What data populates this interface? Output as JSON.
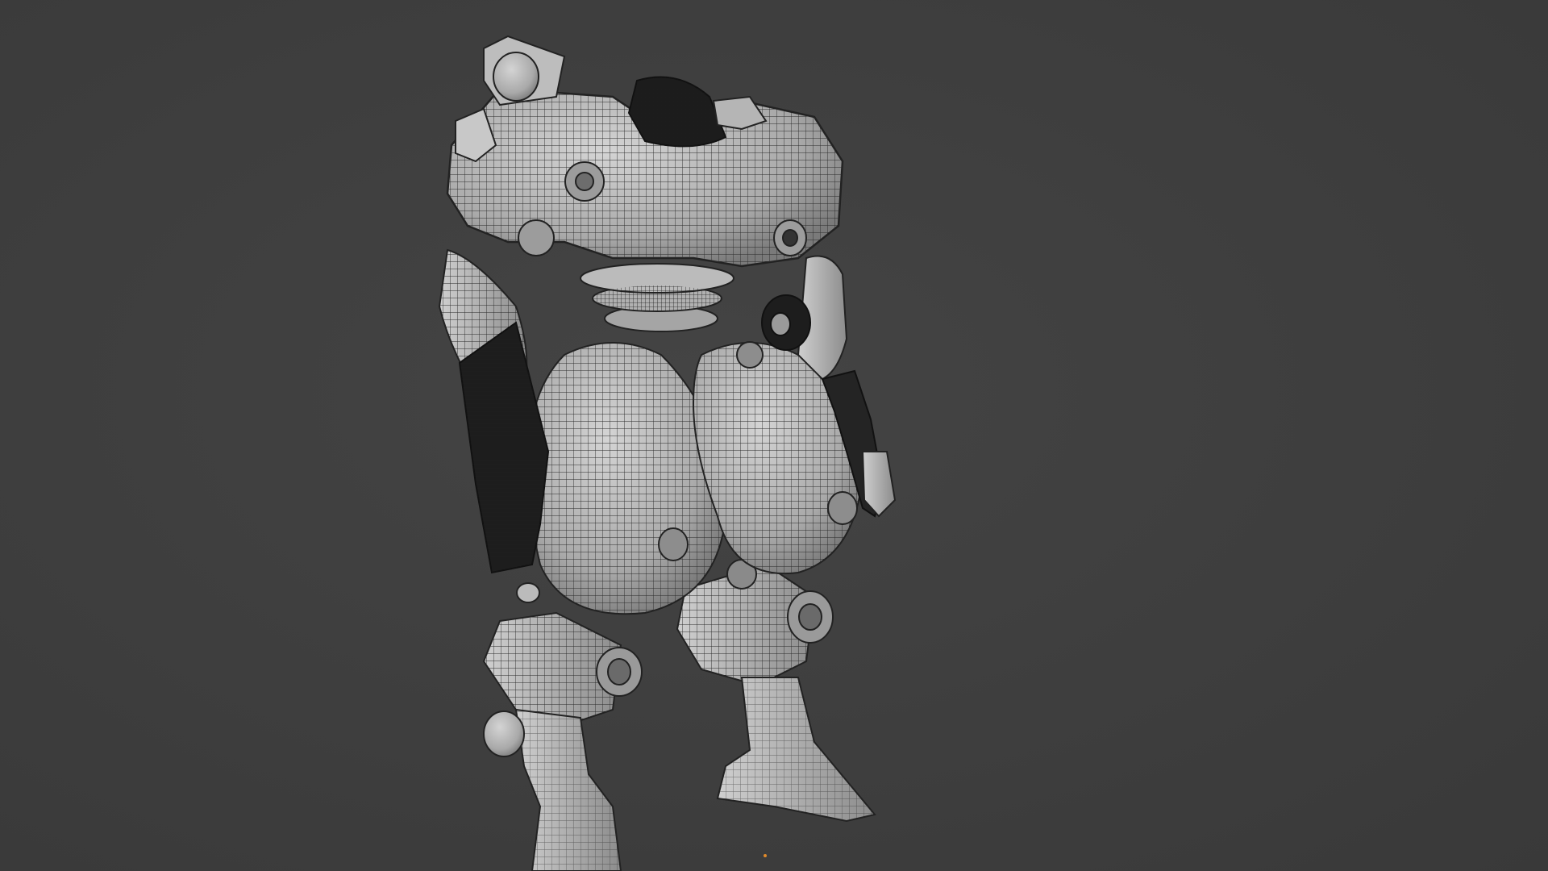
{
  "viewport": {
    "background_color": "#3d3d3d",
    "shading": "solid-with-wireframe-overlay",
    "object_name": "",
    "origin_marker_color": "#e08a2a"
  },
  "model": {
    "subject": "mech-robot",
    "base_color": "#b9b9b9",
    "wire_color": "#2a2a2a",
    "dark_part_color": "#1c1c1c"
  }
}
